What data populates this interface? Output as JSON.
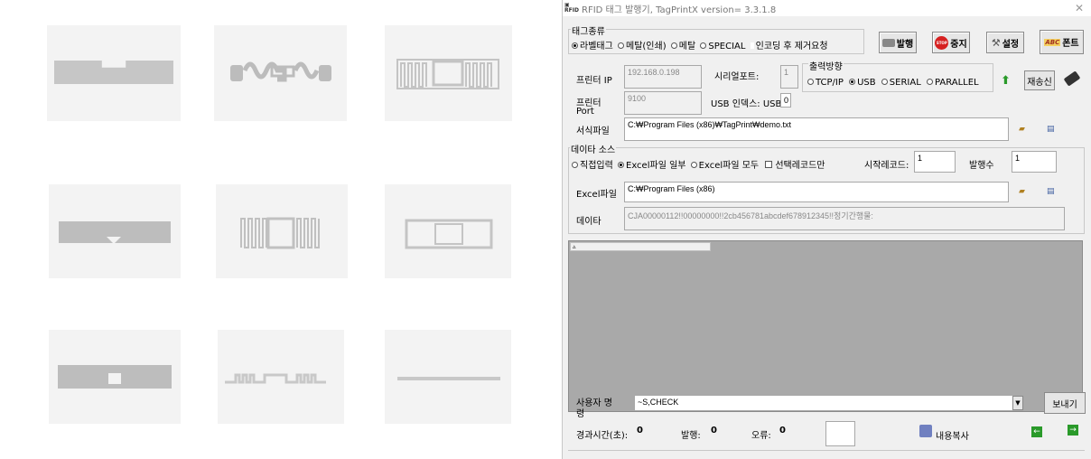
{
  "window": {
    "title": "RFID 태그 발행기, TagPrintX version= 3.3.1.8",
    "logo": "RFID"
  },
  "tag_type": {
    "label": "태그종류",
    "options": [
      "라벨태그",
      "메탈(인쇄)",
      "메탈",
      "SPECIAL",
      "인코딩 후 제거요청"
    ],
    "selected": "라벨태그"
  },
  "toolbar": {
    "issue_label": "발행",
    "stop_label": "중지",
    "settings_label": "설정",
    "font_label": "폰트",
    "stop_icon_text": "STOP",
    "font_icon_text": "ABC"
  },
  "printer": {
    "ip_label": "프린터 IP",
    "ip_value": "192.168.0.198",
    "serial_port_label": "시리얼포트:",
    "serial_port_value": "1",
    "port_label": "프린터 Port",
    "port_value": "9100",
    "usb_index_label": "USB 인덱스: USB",
    "usb_index_value": "0"
  },
  "output": {
    "label": "출력방향",
    "options": [
      "TCP/IP",
      "USB",
      "SERIAL",
      "PARALLEL"
    ],
    "selected": "USB",
    "resend_label": "재송신"
  },
  "format_file": {
    "label": "서식파일",
    "value": "C:₩Program Files (x86)₩TagPrint₩demo.txt"
  },
  "data_source": {
    "label": "데이타 소스",
    "options": [
      "직접입력",
      "Excel파일 일부",
      "Excel파일 모두"
    ],
    "selected": "Excel파일 일부",
    "selected_only_label": "선택레코드만",
    "start_record_label": "시작레코드:",
    "start_record_value": "1",
    "issue_count_label": "발행수",
    "issue_count_value": "1",
    "excel_label": "Excel파일",
    "excel_value": "C:₩Program Files (x86)",
    "data_label": "데이타",
    "data_value": "CJA00000112!!00000000!!2cb456781abcdef678912345!!정기간행물:"
  },
  "log": {
    "tab_label": "▵"
  },
  "command": {
    "label": "사용자 명령",
    "value": "~S,CHECK",
    "send_label": "보내기"
  },
  "status": {
    "elapsed_label": "경과시간(초):",
    "elapsed_value": "0",
    "issued_label": "발행:",
    "issued_value": "0",
    "error_label": "오류:",
    "error_value": "0",
    "copy_label": "내용복사"
  },
  "colors": {
    "window_bg": "#f0f0f0",
    "log_area": "#a9a9a9",
    "tag_tile": "#f3f3f3",
    "tag_shape": "#c4c4c4",
    "stop_red": "#d62020",
    "green_arrow": "#2a9a2a"
  }
}
